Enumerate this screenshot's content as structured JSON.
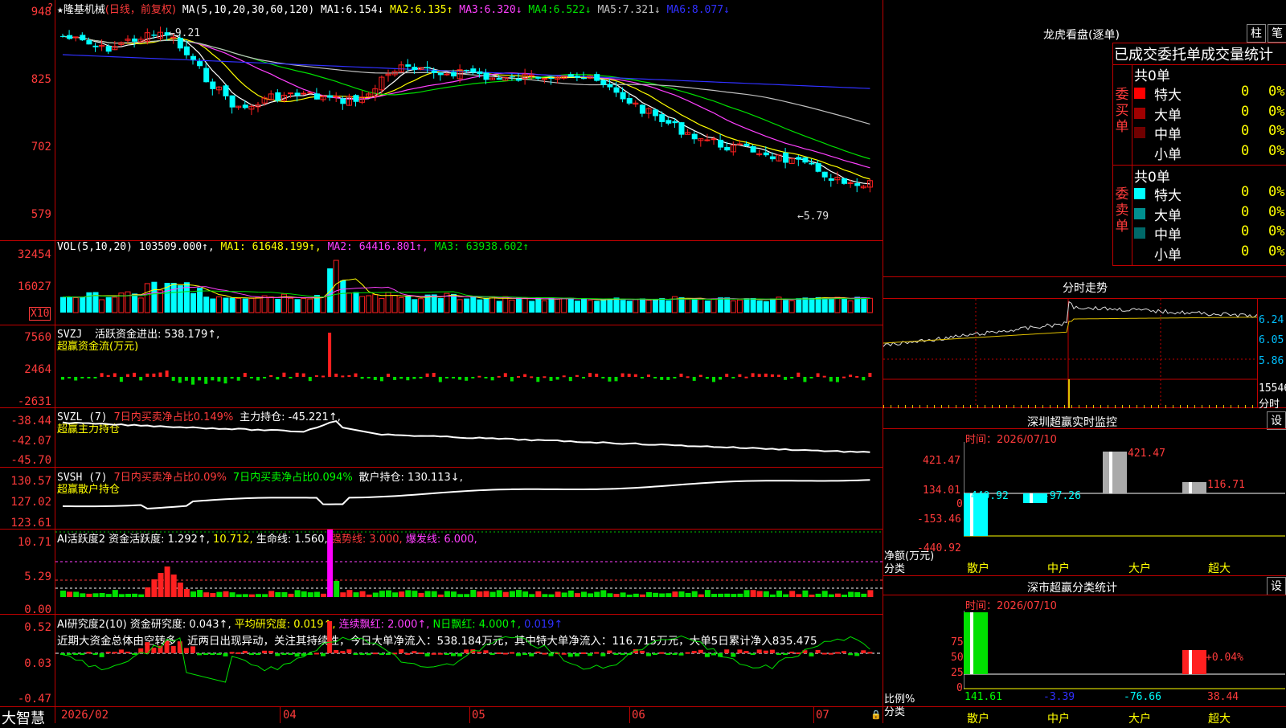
{
  "stock": {
    "name": "隆基机械",
    "period": "(日线，前复权)"
  },
  "colors": {
    "ma1": "#ffffff",
    "ma2": "#ffff00",
    "ma3": "#ff40ff",
    "ma4": "#00e000",
    "ma5": "#c0c0c0",
    "ma6": "#3030ff",
    "up": "#ff2020",
    "down": "#00ffff",
    "axis": "#ff3b3b",
    "grid": "#c00000"
  },
  "main": {
    "axis": [
      "948",
      "825",
      "702",
      "579"
    ],
    "ma_prefix": "MA(5,10,20,30,60,120)",
    "ma_values": [
      {
        "label": "MA1:",
        "value": "6.154↓"
      },
      {
        "label": "MA2:",
        "value": "6.135↑"
      },
      {
        "label": "MA3:",
        "value": "6.320↓"
      },
      {
        "label": "MA4:",
        "value": "6.522↓"
      },
      {
        "label": "MA5:",
        "value": "7.321↓"
      },
      {
        "label": "MA6:",
        "value": "8.077↓"
      }
    ],
    "high_note": "9.21",
    "low_note": "5.79"
  },
  "vol": {
    "axis": [
      "32454",
      "16027"
    ],
    "unit": "X10",
    "header_prefix": "VOL(5,10,20)",
    "header_value": "103509.000↑,",
    "ma1": "MA1: 61648.199↑,",
    "ma2": "MA2: 64416.801↑,",
    "ma3": "MA3: 63938.602↑"
  },
  "svzj": {
    "axis": [
      "7560",
      "2464",
      "-2631"
    ],
    "line1_name": "SVZJ",
    "line1_text": "活跃资金进出: 538.179↑,",
    "line2": "超赢资金流(万元)"
  },
  "svzl": {
    "axis": [
      "-38.44",
      "-42.07",
      "-45.70"
    ],
    "name": "SVZL (7)",
    "ratio": "7日内买卖净占比0.149%",
    "hold": "主力持仓: -45.221↑,",
    "line2": "超赢主力持仓"
  },
  "svsh": {
    "axis": [
      "130.57",
      "127.02",
      "123.61"
    ],
    "name": "SVSH (7)",
    "ratio1": "7日内买卖净占比0.09%",
    "ratio2": "7日内买卖净占比0.094%",
    "hold": "散户持仓: 130.113↓,",
    "line2": "超赢散户持仓"
  },
  "ai1": {
    "axis": [
      "10.71",
      "5.29",
      "0.00"
    ],
    "name": "AI活跃度2",
    "active": "资金活跃度: 1.292↑,",
    "v2": "10.712,",
    "life": "生命线: 1.560,",
    "strong": "强势线: 3.000,",
    "burst": "爆发线: 6.000,"
  },
  "ai2": {
    "axis": [
      "0.52",
      "0.03",
      "-0.47"
    ],
    "name": "AI研究度2(10)",
    "research": "资金研究度: 0.043↑,",
    "avg": "平均研究度: 0.019↑,",
    "red": "连续飘红: 2.000↑,",
    "nred": "N日飘红: 4.000↑,",
    "v5": "0.019↑",
    "comment": "近期大资金总体由空转多，近两日出现异动，关注其持续性，今日大单净流入：538.184万元，其中特大单净流入：116.715万元，大单5日累计净入835.475"
  },
  "bottom": {
    "logo": "大智慧",
    "dates": [
      "2026/02",
      "04",
      "05",
      "06",
      "07"
    ]
  },
  "right": {
    "dragon_title": "龙虎看盘(逐单)",
    "btn_col": "柱",
    "btn_pen": "笔",
    "stat_title": "已成交委托单成交量统计",
    "buy_label": "委买单",
    "sell_label": "委卖单",
    "buy_total": "共0单",
    "sell_total": "共0单",
    "buy_rows": [
      {
        "name": "特大",
        "count": "0",
        "pct": "0%",
        "color": "#ff0000"
      },
      {
        "name": "大单",
        "count": "0",
        "pct": "0%",
        "color": "#a00000"
      },
      {
        "name": "中单",
        "count": "0",
        "pct": "0%",
        "color": "#700000"
      },
      {
        "name": "小单",
        "count": "0",
        "pct": "0%",
        "color": "#000000"
      }
    ],
    "sell_rows": [
      {
        "name": "特大",
        "count": "0",
        "pct": "0%",
        "color": "#00ffff"
      },
      {
        "name": "大单",
        "count": "0",
        "pct": "0%",
        "color": "#009090"
      },
      {
        "name": "中单",
        "count": "0",
        "pct": "0%",
        "color": "#006868"
      },
      {
        "name": "小单",
        "count": "0",
        "pct": "0%",
        "color": "#000000"
      }
    ],
    "intraday_title": "分时走势",
    "intraday_axis": [
      "6.24",
      "6.05",
      "5.86"
    ],
    "intraday_vol": "15546",
    "intraday_vol_label": "分时",
    "monitor_title": "深圳超赢实时监控",
    "set_btn": "设",
    "time_label": "时间：2026/07/10",
    "monitor_axis": [
      "421.47",
      "134.01",
      "0",
      "-153.46",
      "-440.92"
    ],
    "monitor_values": [
      "-440.92",
      "-97.26",
      "421.47",
      "116.71"
    ],
    "monitor_ylabel": "净额(万元)",
    "category_label": "分类",
    "categories": [
      "散户",
      "中户",
      "大户",
      "超大"
    ],
    "stat2_title": "深市超赢分类统计",
    "time_label2": "时间：2026/07/10",
    "stat2_axis": [
      "75",
      "50",
      "25",
      "0"
    ],
    "stat2_values": [
      "141.61",
      "-3.39",
      "-76.66",
      "38.44"
    ],
    "stat2_pct": "+0.04%",
    "stat2_ylabel": "比例%"
  }
}
